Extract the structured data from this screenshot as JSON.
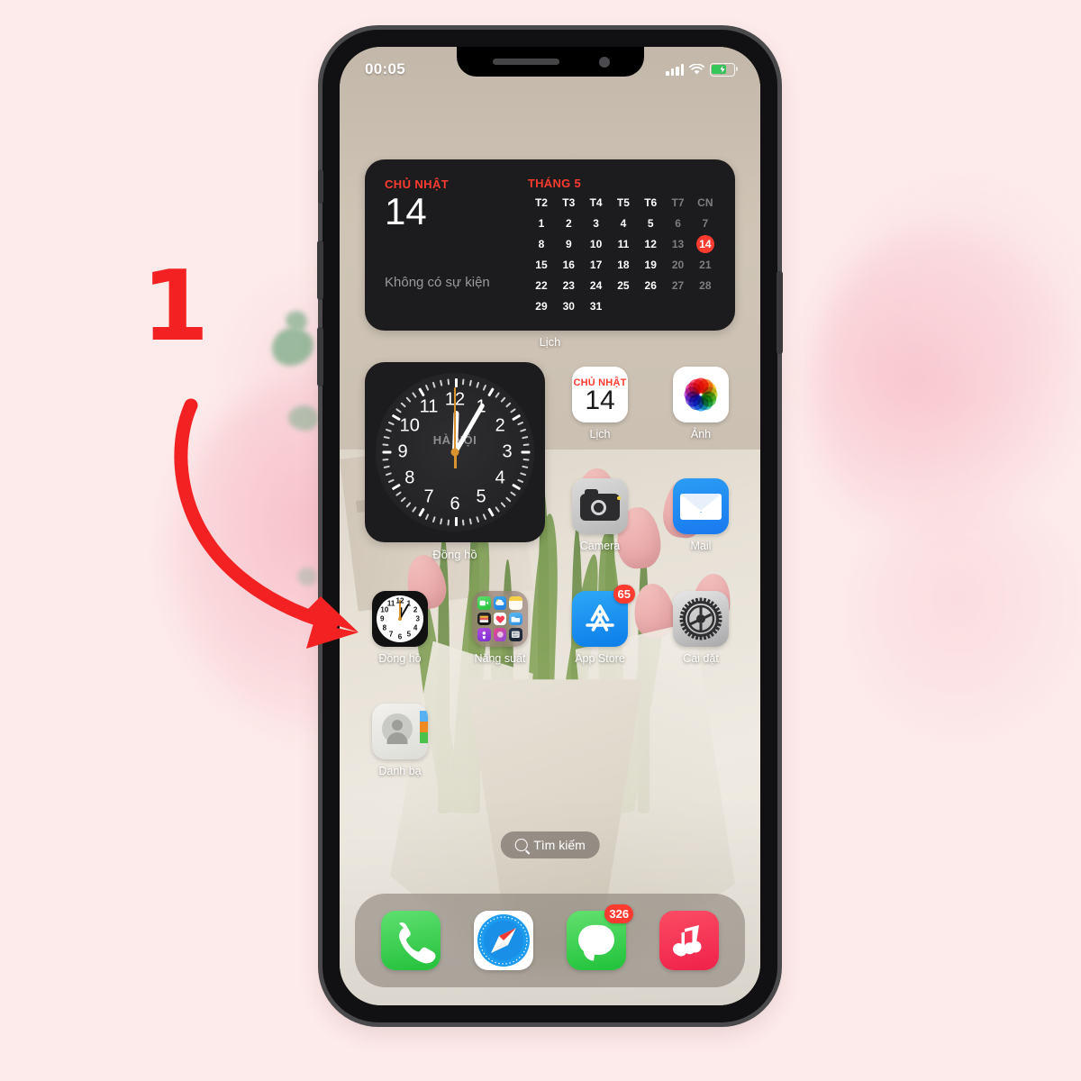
{
  "annotation": {
    "step_number": "1",
    "arrow": "curved-arrow-pointing-to-clock-app"
  },
  "status_bar": {
    "time": "00:05",
    "cellular_icon": "signal-bars-icon",
    "wifi_icon": "wifi-icon",
    "battery_icon": "battery-charging-icon"
  },
  "calendar_widget": {
    "weekday": "CHỦ NHẬT",
    "day": "14",
    "events_text": "Không có sự kiện",
    "month": "THÁNG 5",
    "day_headers": [
      "T2",
      "T3",
      "T4",
      "T5",
      "T6",
      "T7",
      "CN"
    ],
    "weeks": [
      [
        "1",
        "2",
        "3",
        "4",
        "5",
        "6",
        "7"
      ],
      [
        "8",
        "9",
        "10",
        "11",
        "12",
        "13",
        "14"
      ],
      [
        "15",
        "16",
        "17",
        "18",
        "19",
        "20",
        "21"
      ],
      [
        "22",
        "23",
        "24",
        "25",
        "26",
        "27",
        "28"
      ],
      [
        "29",
        "30",
        "31",
        "",
        "",
        "",
        ""
      ]
    ],
    "today": "14",
    "widget_label": "Lịch",
    "accent_color": "#ff3b30"
  },
  "clock_widget": {
    "city": "HÀ NỘI",
    "label": "Đồng hồ",
    "numerals": [
      "1",
      "2",
      "3",
      "4",
      "5",
      "6",
      "7",
      "8",
      "9",
      "10",
      "11",
      "12"
    ],
    "time_shown": "00:05"
  },
  "apps": {
    "row1": [
      {
        "name": "Lịch",
        "icon": "calendar-icon",
        "badge": null,
        "sub_weekday": "CHỦ NHẬT",
        "sub_day": "14"
      },
      {
        "name": "Ảnh",
        "icon": "photos-icon",
        "badge": null
      }
    ],
    "row2": [
      {
        "name": "Camera",
        "icon": "camera-icon",
        "badge": null
      },
      {
        "name": "Mail",
        "icon": "mail-icon",
        "badge": null
      }
    ],
    "row3": [
      {
        "name": "Đồng hồ",
        "icon": "clock-app-icon",
        "badge": null
      },
      {
        "name": "Năng suất",
        "icon": "folder-icon",
        "badge": null
      },
      {
        "name": "App Store",
        "icon": "app-store-icon",
        "badge": "65"
      },
      {
        "name": "Cài đặt",
        "icon": "settings-gear-icon",
        "badge": null
      }
    ],
    "row4": [
      {
        "name": "Danh bạ",
        "icon": "contacts-icon",
        "badge": null
      }
    ]
  },
  "folder_mini_icons": [
    "facetime-icon",
    "weather-icon",
    "notes-icon",
    "wallet-icon",
    "health-icon",
    "files-icon",
    "podcasts-icon",
    "shortcuts-icon",
    "news-icon"
  ],
  "search": {
    "label": "Tìm kiếm",
    "icon": "search-icon"
  },
  "dock": [
    {
      "name": "Điện thoại",
      "icon": "phone-icon",
      "badge": null
    },
    {
      "name": "Safari",
      "icon": "safari-compass-icon",
      "badge": null
    },
    {
      "name": "Tin nhắn",
      "icon": "messages-icon",
      "badge": "326"
    },
    {
      "name": "Nhạc",
      "icon": "music-note-icon",
      "badge": null
    }
  ],
  "colors": {
    "page_background": "#fdeaea",
    "accent_red": "#ff3b30",
    "annotation_red": "#f32121",
    "widget_background": "#1c1c1e",
    "wallpaper_top": "#cdc1b2"
  }
}
